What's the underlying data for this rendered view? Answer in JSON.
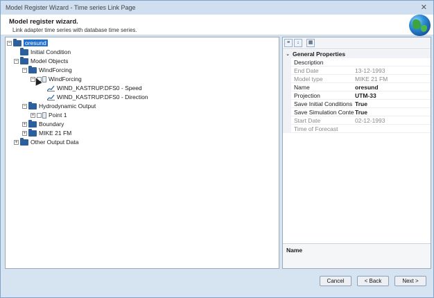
{
  "window": {
    "title": "Model Register Wizard - Time series Link Page",
    "close_glyph": "✕"
  },
  "header": {
    "title": "Model register wizard.",
    "subtitle": "Link adapter time series with database time series."
  },
  "tree": {
    "root": "oresund",
    "initial_condition": "Initial Condition",
    "model_objects": "Model Objects",
    "windforcing_folder": "WindForcing",
    "windforcing_item": "WindForcing",
    "speed": "WIND_KASTRUP.DFS0 - Speed",
    "direction": "WIND_KASTRUP.DFS0 - Direction",
    "hydro_output": "Hydrodynamic Output",
    "point1": "Point 1",
    "boundary": "Boundary",
    "mike21": "MIKE 21 FM",
    "other_output": "Other Output Data"
  },
  "properties": {
    "category": "General Properties",
    "rows": [
      {
        "key": "Description",
        "value": ""
      },
      {
        "key": "End Date",
        "value": "13-12-1993"
      },
      {
        "key": "Model type",
        "value": "MIKE 21 FM"
      },
      {
        "key": "Name",
        "value": "oresund"
      },
      {
        "key": "Projection",
        "value": "UTM-33"
      },
      {
        "key": "Save Initial Conditions to",
        "value": "True"
      },
      {
        "key": "Save Simulation Content",
        "value": "True"
      },
      {
        "key": "Start Date",
        "value": "02-12-1993"
      },
      {
        "key": "Time of Forecast",
        "value": ""
      }
    ],
    "desc_name": "Name"
  },
  "buttons": {
    "cancel": "Cancel",
    "back": "< Back",
    "next": "Next >"
  },
  "colors": {
    "accent": "#1f6fd0",
    "folder": "#2b5f9e"
  }
}
